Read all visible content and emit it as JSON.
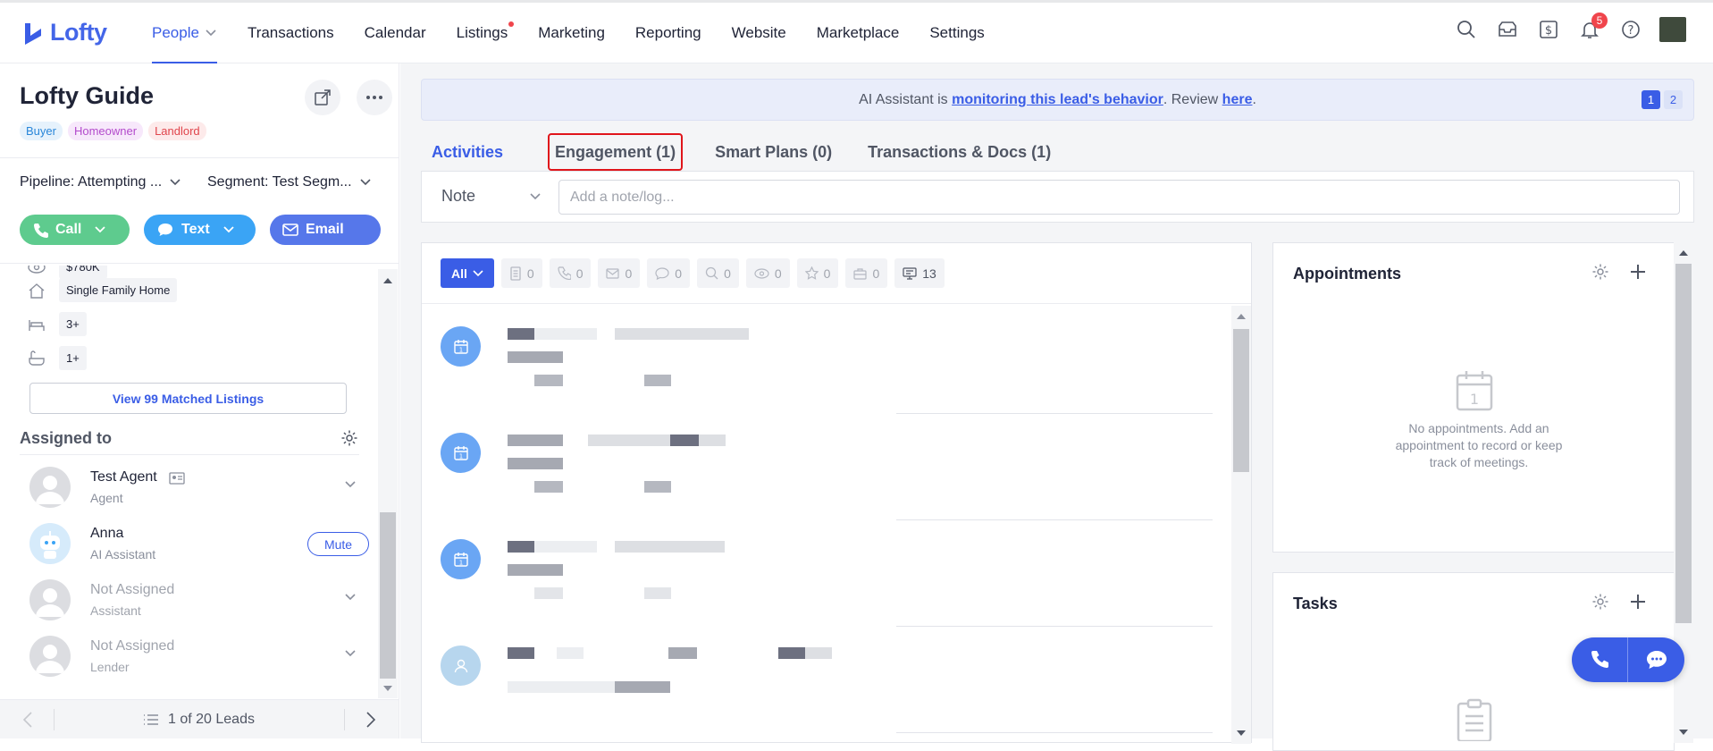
{
  "app": {
    "logo_text": "Lofty",
    "brand_color": "#3a5de6"
  },
  "nav": {
    "items": [
      {
        "label": "People",
        "active": true
      },
      {
        "label": "Transactions"
      },
      {
        "label": "Calendar"
      },
      {
        "label": "Listings",
        "dot": true
      },
      {
        "label": "Marketing"
      },
      {
        "label": "Reporting"
      },
      {
        "label": "Website"
      },
      {
        "label": "Marketplace"
      },
      {
        "label": "Settings"
      }
    ],
    "notification_count": "5"
  },
  "lead": {
    "name": "Lofty Guide",
    "tags": [
      "Buyer",
      "Homeowner",
      "Landlord"
    ],
    "pipeline_label": "Pipeline: Attempting ...",
    "segment_label": "Segment: Test Segm..."
  },
  "actions": {
    "call": "Call",
    "text": "Text",
    "email": "Email"
  },
  "property": {
    "price_partial": "$780K",
    "home_type": "Single Family Home",
    "beds": "3+",
    "baths": "1+",
    "view_listings": "View 99 Matched Listings"
  },
  "assigned": {
    "title": "Assigned to",
    "people": [
      {
        "name": "Test Agent",
        "role": "Agent"
      },
      {
        "name": "Anna",
        "role": "AI Assistant",
        "button": "Mute"
      },
      {
        "name": "Not Assigned",
        "role": "Assistant"
      },
      {
        "name": "Not Assigned",
        "role": "Lender"
      }
    ]
  },
  "footer": {
    "leads_counter": "1 of 20 Leads"
  },
  "banner": {
    "prefix": "AI Assistant is ",
    "link1": "monitoring this lead's behavior",
    "middle": ". Review ",
    "link2": "here",
    "suffix": ".",
    "pages": [
      "1",
      "2"
    ]
  },
  "tabs": [
    {
      "label": "Activities",
      "active": true
    },
    {
      "label": "Engagement (1)",
      "highlighted": true
    },
    {
      "label": "Smart Plans (0)"
    },
    {
      "label": "Transactions & Docs (1)"
    }
  ],
  "note": {
    "type": "Note",
    "placeholder": "Add a note/log..."
  },
  "filters": {
    "all_label": "All",
    "counts": [
      {
        "icon": "document-icon",
        "count": "0"
      },
      {
        "icon": "phone-icon",
        "count": "0"
      },
      {
        "icon": "mail-icon",
        "count": "0"
      },
      {
        "icon": "chat-icon",
        "count": "0"
      },
      {
        "icon": "search-icon",
        "count": "0"
      },
      {
        "icon": "eye-icon",
        "count": "0"
      },
      {
        "icon": "star-icon",
        "count": "0"
      },
      {
        "icon": "briefcase-icon",
        "count": "0"
      },
      {
        "icon": "monitor-icon",
        "count": "13"
      }
    ]
  },
  "appointments": {
    "title": "Appointments",
    "empty": "No appointments. Add an appointment to record or keep track of meetings."
  },
  "tasks": {
    "title": "Tasks"
  }
}
